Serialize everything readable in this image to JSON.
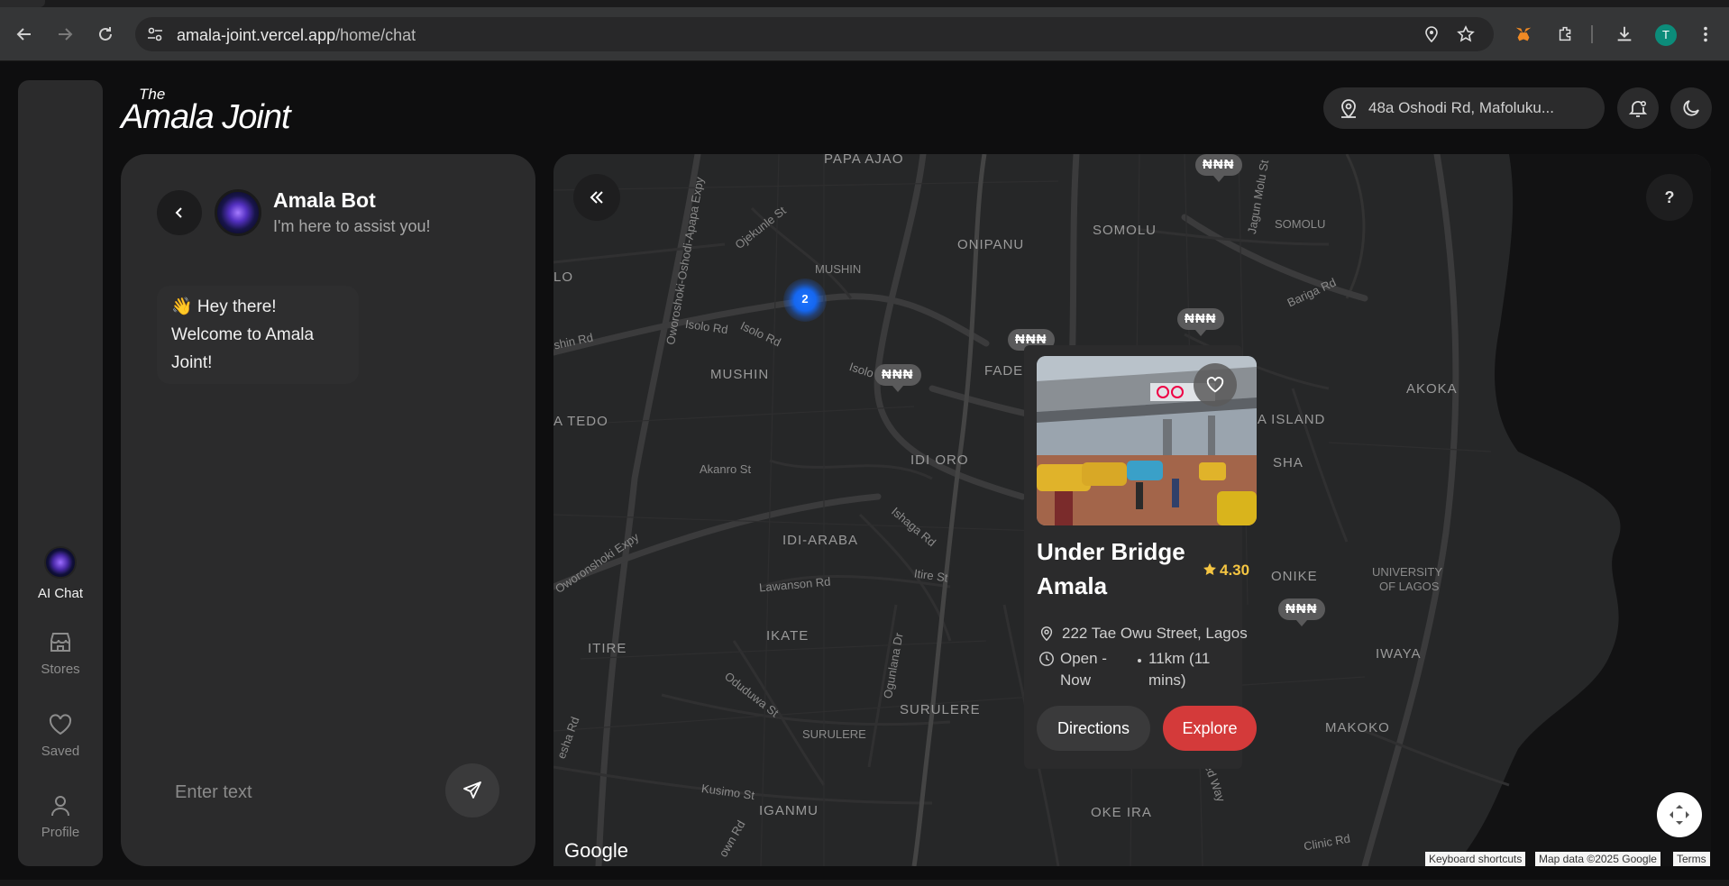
{
  "browser": {
    "url_domain": "amala-joint.vercel.app",
    "url_path": "/home/chat",
    "profile_initial": "T"
  },
  "app": {
    "logo_the": "The",
    "logo_name": "Amala Joint",
    "location": "48a Oshodi Rd, Mafoluku...",
    "sidebar": [
      {
        "label": "AI Chat",
        "icon": "bot-orb"
      },
      {
        "label": "Stores",
        "icon": "store-icon"
      },
      {
        "label": "Saved",
        "icon": "heart-icon"
      },
      {
        "label": "Profile",
        "icon": "user-icon"
      }
    ]
  },
  "chat": {
    "bot_name": "Amala Bot",
    "bot_subtitle": "I'm here to assist you!",
    "welcome_message": "👋 Hey there! Welcome to Amala Joint!",
    "input_placeholder": "Enter text"
  },
  "map": {
    "labels": [
      {
        "text": "PAPA AJAO"
      },
      {
        "text": "SOMOLU"
      },
      {
        "text": "SOMOLU"
      },
      {
        "text": "ONIPANU"
      },
      {
        "text": "MUSHIN"
      },
      {
        "text": "MUSHIN"
      },
      {
        "text": "FADE"
      },
      {
        "text": "AKOKA"
      },
      {
        "text": "ANA ISLAND"
      },
      {
        "text": "A TEDO"
      },
      {
        "text": "IDI ORO"
      },
      {
        "text": "SHA"
      },
      {
        "text": "IDI-ARABA"
      },
      {
        "text": "ONIKE"
      },
      {
        "text": "UNIVERSITY"
      },
      {
        "text": "OF LAGOS"
      },
      {
        "text": "IKATE"
      },
      {
        "text": "ITIRE"
      },
      {
        "text": "IWAYA"
      },
      {
        "text": "SURULERE"
      },
      {
        "text": "SURULERE"
      },
      {
        "text": "MAKOKO"
      },
      {
        "text": "IGANMU"
      },
      {
        "text": "OKE IRA"
      },
      {
        "text": "LO"
      }
    ],
    "street_labels": [
      {
        "text": "Oworoshoki-Oshodi-Apapa Expy"
      },
      {
        "text": "Ojekunle St"
      },
      {
        "text": "Isolo Rd"
      },
      {
        "text": "Isolo Rd"
      },
      {
        "text": "Isolo"
      },
      {
        "text": "shin Rd"
      },
      {
        "text": "Akanro St"
      },
      {
        "text": "Ishaga Rd"
      },
      {
        "text": "Lawanson Rd"
      },
      {
        "text": "Itire St"
      },
      {
        "text": "Ogunlana Dr"
      },
      {
        "text": "Oduduwa St"
      },
      {
        "text": "Kusimo St"
      },
      {
        "text": "Jagun Molu St"
      },
      {
        "text": "Bariga Rd"
      },
      {
        "text": "Clinic Rd"
      },
      {
        "text": "Oworonshoki Expy"
      },
      {
        "text": "ed Way"
      },
      {
        "text": "own Rd"
      },
      {
        "text": "esha Rd"
      }
    ],
    "price_pins": [
      {
        "text": "₦₦₦"
      },
      {
        "text": "₦₦₦"
      },
      {
        "text": "₦₦₦"
      },
      {
        "text": "₦₦₦"
      },
      {
        "text": "₦₦₦"
      },
      {
        "text": "₦"
      }
    ],
    "cluster_count": "2",
    "help": "?",
    "google": "Google",
    "attribution": [
      "Keyboard shortcuts",
      "Map data ©2025 Google",
      "Terms"
    ]
  },
  "place": {
    "name": "Under Bridge Amala",
    "rating": "4.30",
    "address": "222 Tae Owu Street, Lagos",
    "status": "Open - Now",
    "distance": "11km (11 mins)",
    "directions_label": "Directions",
    "explore_label": "Explore"
  },
  "colors": {
    "accent_red": "#d43a3a",
    "rating_gold": "#f5c542",
    "cluster_blue": "#1e74ff"
  }
}
